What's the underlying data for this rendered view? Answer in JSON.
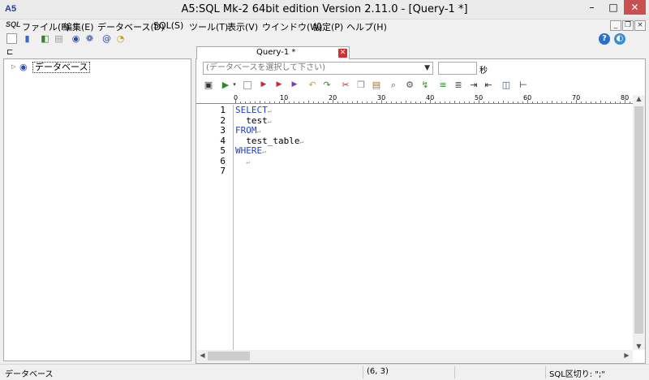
{
  "window": {
    "title": "A5:SQL Mk-2 64bit edition Version 2.11.0 - [Query-1 *]",
    "app_icon": "A5",
    "min": "–",
    "max": "□",
    "close": "✕"
  },
  "menu": {
    "sql_icon": "SQL",
    "items": [
      "ファイル(F)",
      "編集(E)",
      "データベース(D)",
      "SQL(S)",
      "ツール(T)",
      "表示(V)",
      "ウインドウ(W)",
      "設定(P)",
      "ヘルプ(H)"
    ],
    "mdi_min": "_",
    "mdi_restore": "❐",
    "mdi_close": "×"
  },
  "toolbar": {
    "icons": [
      "new-page-icon",
      "open-folder-icon",
      "database-icon",
      "copy-icon",
      "db-connect-icon",
      "settings-gear-icon",
      "at-sign-icon",
      "clock-icon"
    ],
    "help_button": "?",
    "web_button": "◐"
  },
  "tree": {
    "root_label": "データベース"
  },
  "tab": {
    "label": "Query-1 *",
    "close": "✕"
  },
  "query": {
    "db_select_placeholder": "(データベースを選択して下さい)",
    "seconds_value": "",
    "seconds_label": "秒"
  },
  "ruler": {
    "labels": [
      "0",
      "10",
      "20",
      "30",
      "40",
      "50",
      "60",
      "70",
      "80"
    ]
  },
  "editor": {
    "line_numbers": [
      "1",
      "2",
      "3",
      "4",
      "5",
      "6",
      "7"
    ],
    "lines": [
      {
        "text": "SELECT",
        "keyword": true,
        "eol": "↵"
      },
      {
        "text": "  test",
        "keyword": false,
        "eol": "↵"
      },
      {
        "text": "FROM",
        "keyword": true,
        "eol": "↵"
      },
      {
        "text": "  test_table",
        "keyword": false,
        "eol": "↵"
      },
      {
        "text": "WHERE",
        "keyword": true,
        "eol": "↵"
      },
      {
        "text": "  ",
        "keyword": false,
        "eol": "↵"
      },
      {
        "text": "",
        "keyword": false,
        "eol": ""
      }
    ]
  },
  "status": {
    "left": "データベース",
    "cursor_pos": "(6, 3)",
    "sql_separator": "SQL区切り: \";\""
  },
  "colors": {
    "keyword": "#1f3fc8",
    "close_button": "#c75050"
  }
}
